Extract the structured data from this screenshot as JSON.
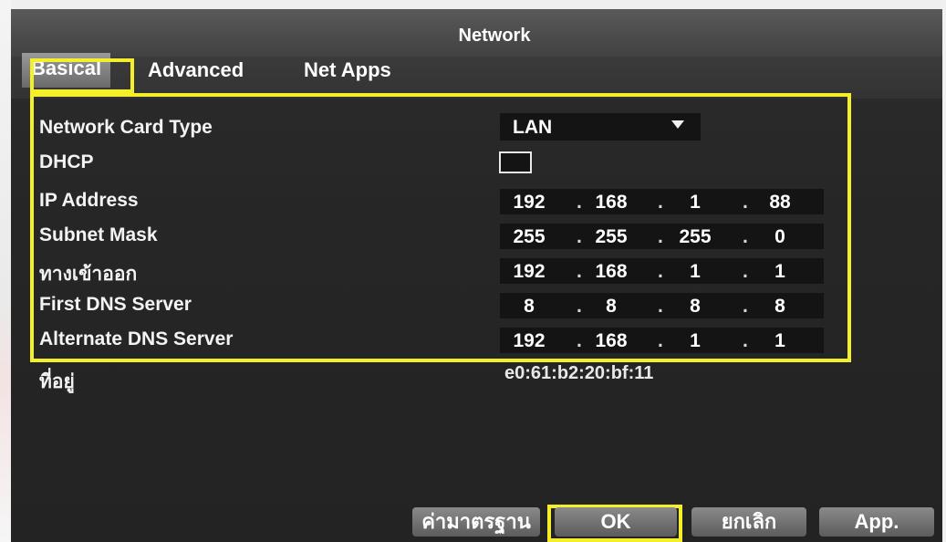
{
  "window": {
    "title": "Network"
  },
  "tabs": [
    {
      "label": "Basical",
      "active": true
    },
    {
      "label": "Advanced",
      "active": false
    },
    {
      "label": "Net Apps",
      "active": false
    }
  ],
  "fields": {
    "network_card_type": {
      "label": "Network Card Type",
      "value": "LAN"
    },
    "dhcp": {
      "label": "DHCP",
      "checked": false
    },
    "ip_address": {
      "label": "IP Address",
      "parts": [
        "192",
        "168",
        "1",
        "88"
      ]
    },
    "subnet_mask": {
      "label": "Subnet Mask",
      "parts": [
        "255",
        "255",
        "255",
        "0"
      ]
    },
    "gateway": {
      "label": "ทางเข้าออก",
      "parts": [
        "192",
        "168",
        "1",
        "1"
      ]
    },
    "first_dns": {
      "label": "First DNS Server",
      "parts": [
        "8",
        "8",
        "8",
        "8"
      ]
    },
    "alternate_dns": {
      "label": "Alternate DNS Server",
      "parts": [
        "192",
        "168",
        "1",
        "1"
      ]
    },
    "mac": {
      "label": "ที่อยู่",
      "value": "e0:61:b2:20:bf:11"
    }
  },
  "ip_separator": ".",
  "buttons": {
    "default": "ค่ามาตรฐาน",
    "ok": "OK",
    "cancel": "ยกเลิก",
    "apply": "App."
  },
  "colors": {
    "highlight": "#f5ee2a",
    "background": "#262626",
    "title_bar": "#4a4a4a"
  }
}
